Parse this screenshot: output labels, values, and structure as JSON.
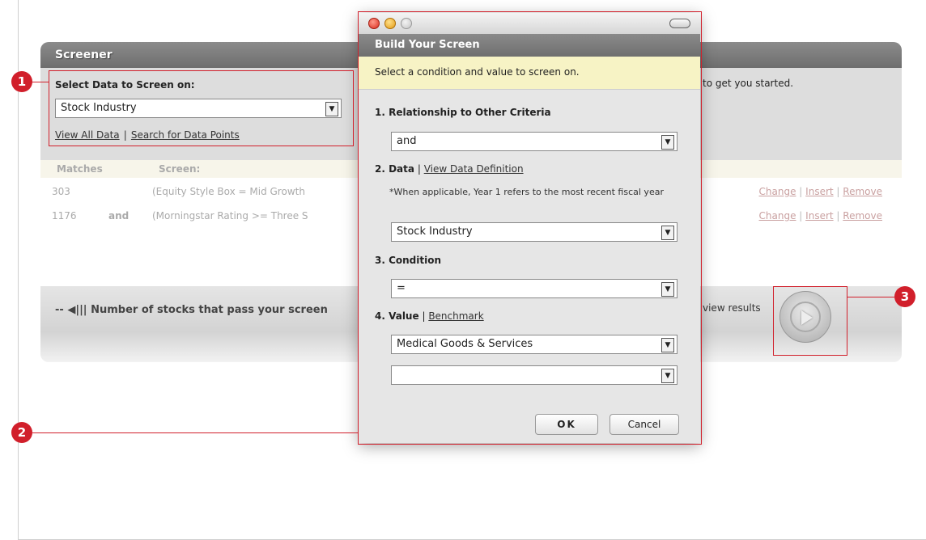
{
  "screener": {
    "title": "Screener",
    "select_label": "Select Data to Screen on:",
    "select_value": "Stock Industry",
    "link_view_all": "View All Data",
    "link_separator": "|",
    "link_search": "Search for Data Points",
    "started_text": "to get you started.",
    "columns": {
      "matches": "Matches",
      "screen": "Screen:"
    },
    "rows": [
      {
        "matches": "303",
        "conj": "",
        "screen": "(Equity Style Box = Mid Growth"
      },
      {
        "matches": "1176",
        "conj": "and",
        "screen": "(Morningstar Rating >= Three S"
      }
    ],
    "row_links": {
      "change": "Change",
      "insert": "Insert",
      "remove": "Remove",
      "sep": "|"
    },
    "count_text": "-- ◀||| Number of stocks that pass your screen",
    "view_results": "view results"
  },
  "dialog": {
    "header": "Build Your Screen",
    "note": "Select a condition and value to screen on.",
    "s1_label": "1. Relationship to Other Criteria",
    "s1_value": "and",
    "s2_label": "2. Data",
    "s2_sep": "|",
    "s2_link": "View Data Definition",
    "s2_note": "*When applicable, Year 1 refers to the most recent fiscal year",
    "s2_value": "Stock Industry",
    "s3_label": "3. Condition",
    "s3_value": "=",
    "s4_label": "4. Value",
    "s4_sep": "|",
    "s4_link": "Benchmark",
    "s4_value": "Medical Goods & Services",
    "s4_value2": "",
    "ok": "OK",
    "cancel": "Cancel"
  },
  "annotations": {
    "one": "1",
    "two": "2",
    "three": "3",
    "color": "#d11f2b"
  }
}
